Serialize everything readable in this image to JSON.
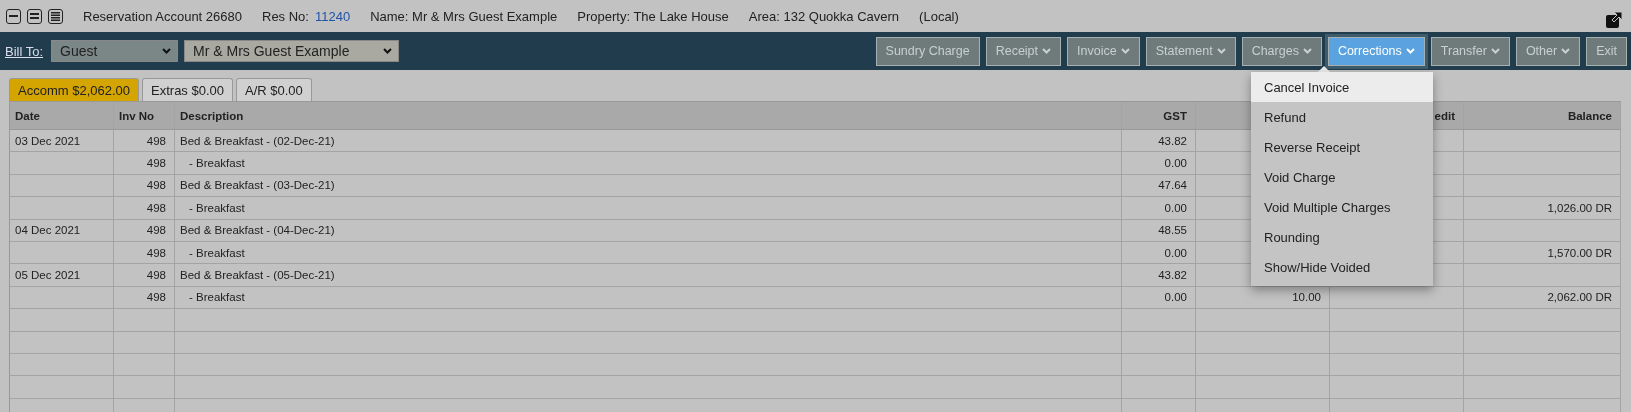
{
  "header": {
    "account": "Reservation Account 26680",
    "res_no_label": "Res No:",
    "res_no": "11240",
    "name": "Name: Mr & Mrs Guest Example",
    "property": "Property: The Lake House",
    "area": "Area: 132 Quokka Cavern",
    "scope": "(Local)"
  },
  "toolbar": {
    "bill_to_label": "Bill To:",
    "bill_to_type": "Guest",
    "bill_to_name": "Mr & Mrs Guest Example",
    "buttons": [
      {
        "label": "Sundry Charge",
        "caret": false,
        "selected": false
      },
      {
        "label": "Receipt",
        "caret": true,
        "selected": false
      },
      {
        "label": "Invoice",
        "caret": true,
        "selected": false
      },
      {
        "label": "Statement",
        "caret": true,
        "selected": false
      },
      {
        "label": "Charges",
        "caret": true,
        "selected": false
      },
      {
        "label": "Corrections",
        "caret": true,
        "selected": true
      },
      {
        "label": "Transfer",
        "caret": true,
        "selected": false
      },
      {
        "label": "Other",
        "caret": true,
        "selected": false
      },
      {
        "label": "Exit",
        "caret": false,
        "selected": false
      }
    ]
  },
  "menu": {
    "items": [
      {
        "label": "Cancel Invoice",
        "highlighted": true
      },
      {
        "label": "Refund",
        "highlighted": false
      },
      {
        "label": "Reverse Receipt",
        "highlighted": false
      },
      {
        "label": "Void Charge",
        "highlighted": false
      },
      {
        "label": "Void Multiple Charges",
        "highlighted": false
      },
      {
        "label": "Rounding",
        "highlighted": false
      },
      {
        "label": "Show/Hide Voided",
        "highlighted": false
      }
    ]
  },
  "tabs": [
    {
      "label": "Accomm $2,062.00",
      "selected": true
    },
    {
      "label": "Extras $0.00",
      "selected": false
    },
    {
      "label": "A/R $0.00",
      "selected": false
    }
  ],
  "table": {
    "columns": {
      "date": "Date",
      "inv_no": "Inv No",
      "description": "Description",
      "gst": "GST",
      "column_6": "edit",
      "balance": "Balance"
    },
    "rows": [
      {
        "date": "03 Dec 2021",
        "inv_no": "498",
        "description": "Bed & Breakfast - (02-Dec-21)",
        "gst": "43.82"
      },
      {
        "inv_no": "498",
        "description": "- Breakfast",
        "sub": true,
        "gst": "0.00"
      },
      {
        "inv_no": "498",
        "description": "Bed & Breakfast - (03-Dec-21)",
        "gst": "47.64"
      },
      {
        "inv_no": "498",
        "description": "- Breakfast",
        "sub": true,
        "gst": "0.00",
        "balance": "1,026.00 DR"
      },
      {
        "date": "04 Dec 2021",
        "inv_no": "498",
        "description": "Bed & Breakfast - (04-Dec-21)",
        "gst": "48.55"
      },
      {
        "inv_no": "498",
        "description": "- Breakfast",
        "sub": true,
        "gst": "0.00",
        "balance": "1,570.00 DR"
      },
      {
        "date": "05 Dec 2021",
        "inv_no": "498",
        "description": "Bed & Breakfast - (05-Dec-21)",
        "gst": "43.82"
      },
      {
        "inv_no": "498",
        "description": "- Breakfast",
        "sub": true,
        "gst": "0.00",
        "column_5": "10.00",
        "balance": "2,062.00 DR"
      }
    ]
  }
}
